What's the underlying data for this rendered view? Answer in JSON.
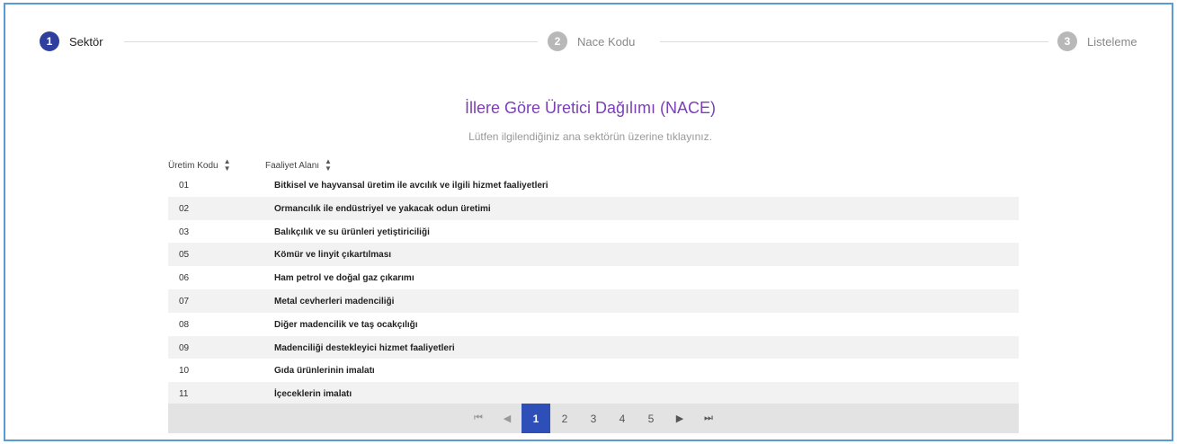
{
  "stepper": {
    "steps": [
      {
        "number": "1",
        "label": "Sektör"
      },
      {
        "number": "2",
        "label": "Nace Kodu"
      },
      {
        "number": "3",
        "label": "Listeleme"
      }
    ]
  },
  "header": {
    "title": "İllere Göre Üretici Dağılımı (NACE)",
    "subtitle": "Lütfen ilgilendiğiniz ana sektörün üzerine tıklayınız."
  },
  "table": {
    "columns": [
      "Üretim Kodu",
      "Faaliyet Alanı"
    ],
    "sort_icon": "sort-icon",
    "rows": [
      {
        "code": "01",
        "name": "Bitkisel ve hayvansal üretim ile avcılık ve ilgili hizmet faaliyetleri"
      },
      {
        "code": "02",
        "name": "Ormancılık ile endüstriyel ve yakacak odun üretimi"
      },
      {
        "code": "03",
        "name": "Balıkçılık ve su ürünleri yetiştiriciliği"
      },
      {
        "code": "05",
        "name": "Kömür ve linyit çıkartılması"
      },
      {
        "code": "06",
        "name": "Ham petrol ve doğal gaz çıkarımı"
      },
      {
        "code": "07",
        "name": "Metal cevherleri madenciliği"
      },
      {
        "code": "08",
        "name": "Diğer madencilik ve taş ocakçılığı"
      },
      {
        "code": "09",
        "name": "Madenciliği destekleyici hizmet faaliyetleri"
      },
      {
        "code": "10",
        "name": "Gıda ürünlerinin imalatı"
      },
      {
        "code": "11",
        "name": "İçeceklerin imalatı"
      }
    ]
  },
  "pagination": {
    "first_icon": "⏮",
    "prev_icon": "◀",
    "pages": [
      "1",
      "2",
      "3",
      "4",
      "5"
    ],
    "current": "1",
    "next_icon": "▶",
    "last_icon": "⏭"
  },
  "colors": {
    "accent": "#2f3f9e",
    "title": "#7b3fb6",
    "border": "#5b9bd5"
  }
}
